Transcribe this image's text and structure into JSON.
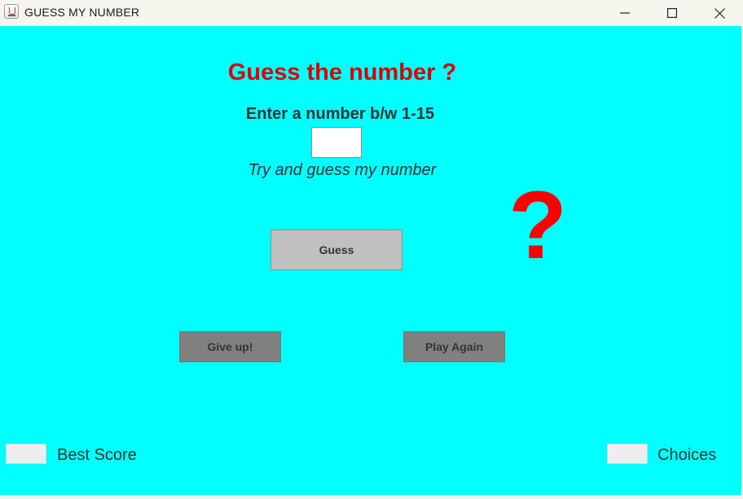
{
  "window": {
    "title": "GUESS MY NUMBER",
    "app_icon": "java-cup-icon",
    "controls": [
      "minimize-icon",
      "maximize-icon",
      "close-icon"
    ]
  },
  "game": {
    "heading": "Guess the number ?",
    "prompt": "Enter a number b/w 1-15",
    "input_value": "",
    "hint": "Try and guess my number",
    "question_mark": "?",
    "guess_button": "Guess",
    "give_up_button": "Give up!",
    "play_again_button": "Play Again"
  },
  "footer": {
    "best_score_label": "Best Score",
    "best_score_value": "",
    "choices_label": "Choices",
    "choices_value": ""
  },
  "colors": {
    "background": "#00ffff",
    "heading": "#e00000",
    "question_mark": "#ff0000",
    "guess_button": "#c0c0c0",
    "action_buttons": "#808080"
  }
}
